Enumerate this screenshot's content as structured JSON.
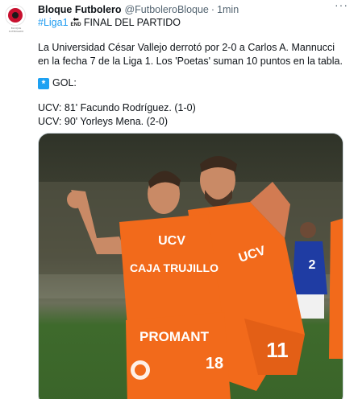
{
  "author": {
    "display_name": "Bloque Futbolero",
    "handle": "@FutboleroBloque",
    "separator": "·",
    "time": "1min",
    "more_label": "···",
    "avatar_icon": "club-crest-icon",
    "avatar_caption": "BLOQUE FUTBOLERO"
  },
  "tweet": {
    "hashtag": "#Liga1",
    "end_icon_label": "END",
    "headline": "FINAL DEL PARTIDO",
    "paragraph": "La Universidad  César Vallejo derrotó por 2-0 a Carlos A. Mannucci en la fecha 7 de la Liga 1. Los 'Poetas' suman 10 puntos en la tabla.",
    "gol_icon": "*",
    "gol_label": "GOL:",
    "goal_1": "UCV: 81' Facundo Rodríguez. (1-0)",
    "goal_2": "UCV: 90' Yorleys Mena. (2-0)"
  },
  "media": {
    "alt": "Two UCV players in orange kits celebrating a goal",
    "jersey_sponsor": "CAJA TRUJILLO",
    "jersey_brand": "UCV",
    "shorts_sponsor": "PROMANT",
    "number_right": "11",
    "number_left": "18",
    "opponent_number": "2",
    "colors": {
      "kit_orange": "#f26a1b",
      "kit_orange_dark": "#c9500f",
      "pitch_green": "#3f6b2e",
      "opponent_blue": "#1f3ca3"
    }
  }
}
